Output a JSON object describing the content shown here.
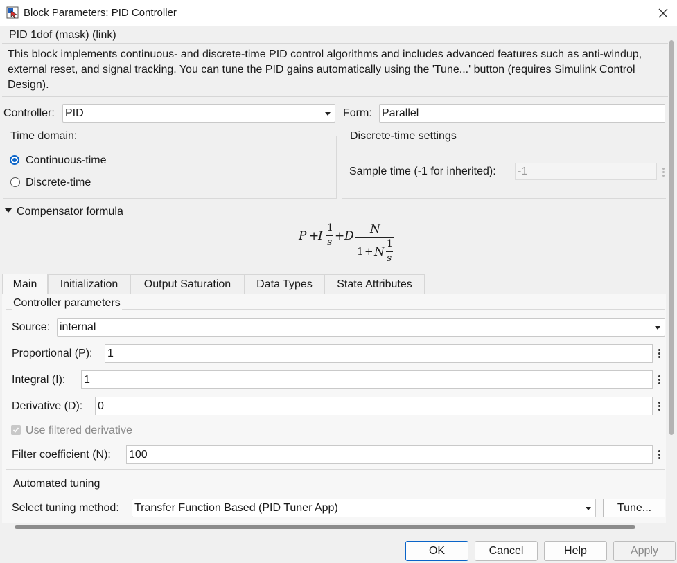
{
  "window": {
    "title": "Block Parameters: PID Controller",
    "icon": "simulink-block-icon",
    "close_icon": "close-icon"
  },
  "header": {
    "mask_title": "PID 1dof (mask) (link)",
    "description": "This block implements continuous- and discrete-time PID control algorithms and includes advanced features such as anti-windup, external reset, and signal tracking. You can tune the PID gains automatically using the 'Tune...' button (requires Simulink Control Design)."
  },
  "controller": {
    "label": "Controller:",
    "value": "PID"
  },
  "form": {
    "label": "Form:",
    "value": "Parallel"
  },
  "time_domain": {
    "title": "Time domain:",
    "options": [
      "Continuous-time",
      "Discrete-time"
    ],
    "selected": "Continuous-time"
  },
  "discrete_settings": {
    "title": "Discrete-time settings",
    "sample_time_label": "Sample time (-1 for inherited):",
    "sample_time_value": "-1"
  },
  "compensator": {
    "title": "Compensator formula",
    "formula": {
      "p": "P",
      "plus1": "+",
      "i": "I",
      "one_a": "1",
      "s_a": "s",
      "plus2": "+",
      "d": "D",
      "n_num": "N",
      "denom_one": "1",
      "plus3": "+",
      "n_den": "N",
      "one_b": "1",
      "s_b": "s"
    }
  },
  "tabs": [
    "Main",
    "Initialization",
    "Output Saturation",
    "Data Types",
    "State Attributes"
  ],
  "active_tab": "Main",
  "controller_parameters": {
    "title": "Controller parameters",
    "source_label": "Source:",
    "source_value": "internal",
    "proportional_label": "Proportional (P):",
    "proportional_value": "1",
    "integral_label": "Integral (I):",
    "integral_value": "1",
    "derivative_label": "Derivative (D):",
    "derivative_value": "0",
    "use_filtered_label": "Use filtered derivative",
    "use_filtered_checked": true,
    "filter_label": "Filter coefficient (N):",
    "filter_value": "100"
  },
  "automated_tuning": {
    "title": "Automated tuning",
    "method_label": "Select tuning method:",
    "method_value": "Transfer Function Based (PID Tuner App)",
    "tune_button": "Tune..."
  },
  "buttons": {
    "ok": "OK",
    "cancel": "Cancel",
    "help": "Help",
    "apply": "Apply"
  },
  "colors": {
    "accent": "#0a64c8",
    "background": "#f0f0f0",
    "field": "#ffffff"
  }
}
